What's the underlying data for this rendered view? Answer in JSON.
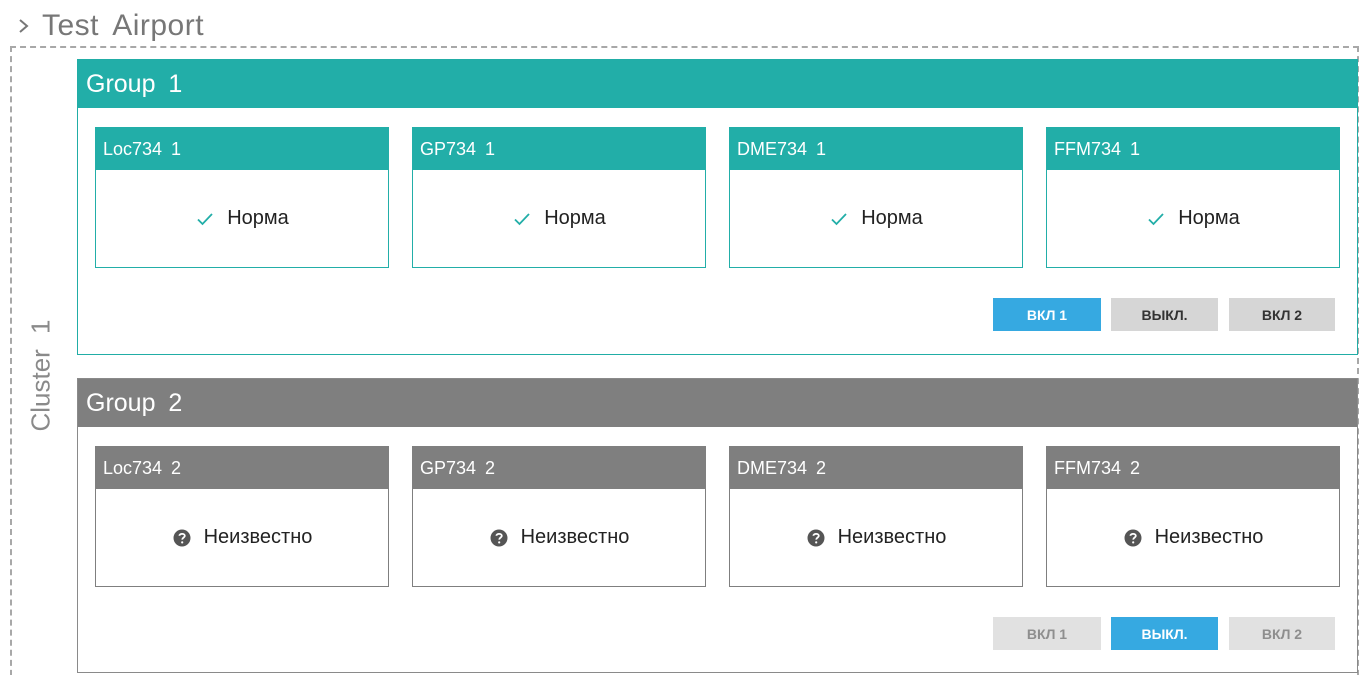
{
  "breadcrumb": {
    "title": "Test  Airport"
  },
  "cluster": {
    "label": "Cluster  1"
  },
  "groups": [
    {
      "title": "Group  1",
      "color": "#22aea8",
      "devices": [
        {
          "name": "Loc734  1",
          "status": "Норма",
          "icon": "check-icon"
        },
        {
          "name": "GP734 1",
          "status": "Норма",
          "icon": "check-icon"
        },
        {
          "name": "DME734  1",
          "status": "Норма",
          "icon": "check-icon"
        },
        {
          "name": "FFM734 1",
          "status": "Норма",
          "icon": "check-icon"
        }
      ],
      "buttons": [
        {
          "label": "ВКЛ 1",
          "state": "active"
        },
        {
          "label": "ВЫКЛ.",
          "state": "inactive"
        },
        {
          "label": "ВКЛ 2",
          "state": "inactive"
        }
      ]
    },
    {
      "title": "Group  2",
      "color": "#7f7f7f",
      "devices": [
        {
          "name": "Loc734 2",
          "status": "Неизвестно",
          "icon": "question-circle-icon"
        },
        {
          "name": "GP734 2",
          "status": "Неизвестно",
          "icon": "question-circle-icon"
        },
        {
          "name": "DME734 2",
          "status": "Неизвестно",
          "icon": "question-circle-icon"
        },
        {
          "name": "FFM734 2",
          "status": "Неизвестно",
          "icon": "question-circle-icon"
        }
      ],
      "buttons": [
        {
          "label": "ВКЛ 1",
          "state": "disabled"
        },
        {
          "label": "ВЫКЛ.",
          "state": "active"
        },
        {
          "label": "ВКЛ 2",
          "state": "disabled"
        }
      ]
    }
  ],
  "colors": {
    "accent_teal": "#22aea8",
    "unknown_gray": "#7f7f7f",
    "button_active": "#36a9e1",
    "button_inactive": "#d6d6d6"
  }
}
